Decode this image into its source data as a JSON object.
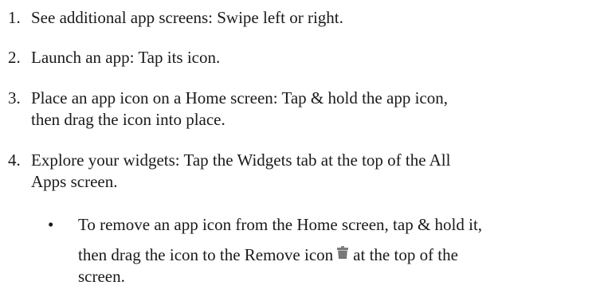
{
  "steps": [
    {
      "number": "1.",
      "lines": [
        "See additional app screens: Swipe left or right."
      ]
    },
    {
      "number": "2.",
      "lines": [
        "Launch an app: Tap its icon."
      ]
    },
    {
      "number": "3.",
      "lines": [
        "Place an app icon on a Home screen: Tap & hold the app icon,",
        "then drag the icon into place."
      ]
    },
    {
      "number": "4.",
      "lines": [
        "Explore your widgets: Tap the Widgets tab at the top of the All",
        "Apps screen."
      ]
    }
  ],
  "bullet": {
    "marker": "•",
    "line1": "To remove an app icon from the Home screen, tap & hold it,",
    "line2_before_icon": "then drag the icon to the Remove icon",
    "icon": "trash-icon",
    "line2_after_icon": "at the top of the",
    "line3": "screen."
  }
}
